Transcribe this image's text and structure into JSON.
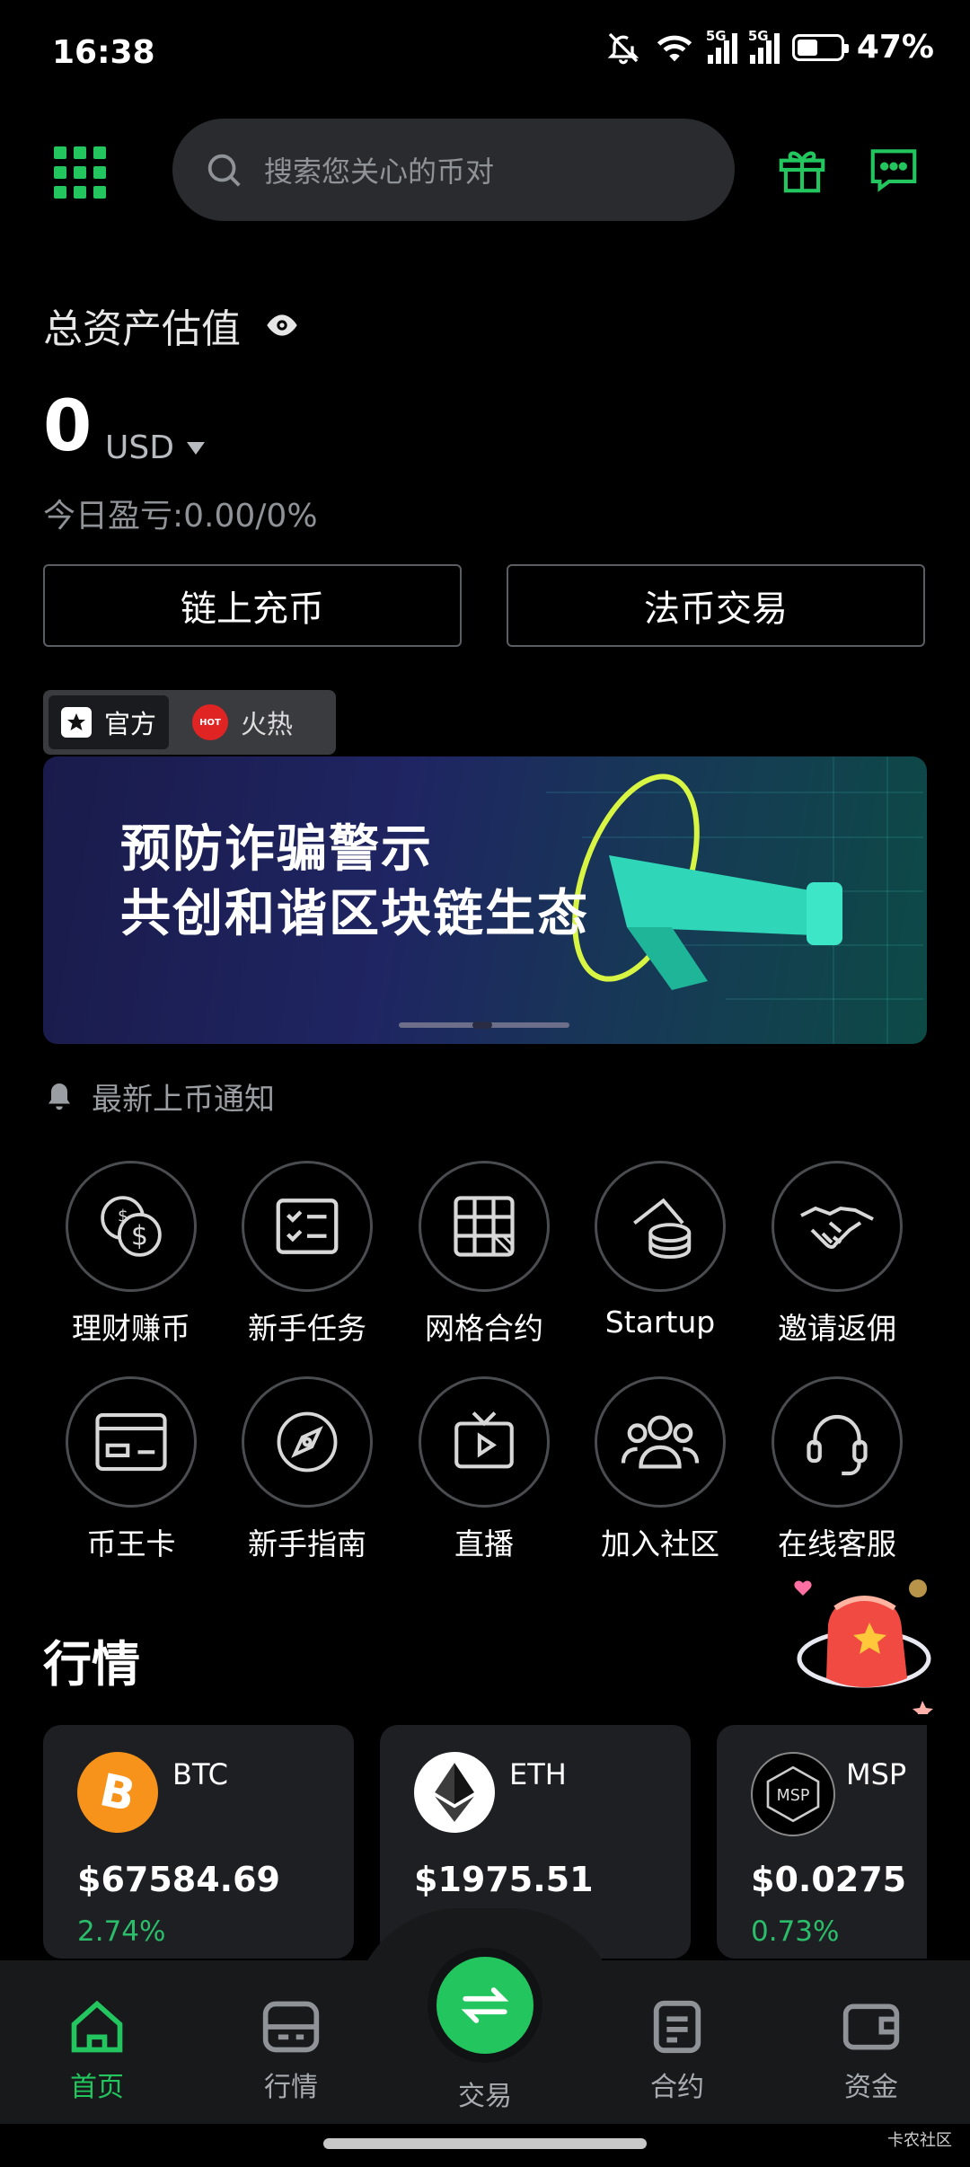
{
  "status": {
    "time": "16:38",
    "network1": "5G",
    "network2": "5G",
    "battery": "47%",
    "battery_level": 0.47
  },
  "header": {
    "search_placeholder": "搜索您关心的币对"
  },
  "assets": {
    "label": "总资产估值",
    "value": "0",
    "currency": "USD",
    "pnl": "今日盈亏:0.00/0%",
    "deposit_button": "链上充币",
    "fiat_button": "法币交易"
  },
  "banner_tabs": [
    {
      "label": "官方"
    },
    {
      "label": "火热",
      "badge": "HOT"
    }
  ],
  "banner": {
    "line1": "预防诈骗警示",
    "line2": "共创和谐区块链生态"
  },
  "notice": "最新上币通知",
  "features": [
    {
      "label": "理财赚币",
      "icon": "coins-icon"
    },
    {
      "label": "新手任务",
      "icon": "checklist-icon"
    },
    {
      "label": "网格合约",
      "icon": "grid-icon"
    },
    {
      "label": "Startup",
      "icon": "token-stack-icon"
    },
    {
      "label": "邀请返佣",
      "icon": "handshake-icon"
    },
    {
      "label": "币王卡",
      "icon": "card-icon"
    },
    {
      "label": "新手指南",
      "icon": "compass-icon"
    },
    {
      "label": "直播",
      "icon": "tv-play-icon"
    },
    {
      "label": "加入社区",
      "icon": "community-icon"
    },
    {
      "label": "在线客服",
      "icon": "headset-icon"
    }
  ],
  "market": {
    "title": "行情",
    "coins": [
      {
        "name": "BTC",
        "price": "$67584.69",
        "change": "2.74%",
        "color": "#f7931a"
      },
      {
        "name": "ETH",
        "price": "$1975.51",
        "change": "",
        "color": "#ffffff"
      },
      {
        "name": "MSP",
        "price": "$0.0275",
        "change": "0.73%",
        "color": "#000000"
      }
    ]
  },
  "nav": {
    "home": "首页",
    "market": "行情",
    "trade": "交易",
    "contract": "合约",
    "funds": "资金"
  },
  "watermark": "卡农社区",
  "colors": {
    "accent": "#22c55e",
    "up": "#2bbd6a",
    "background": "#000000"
  }
}
